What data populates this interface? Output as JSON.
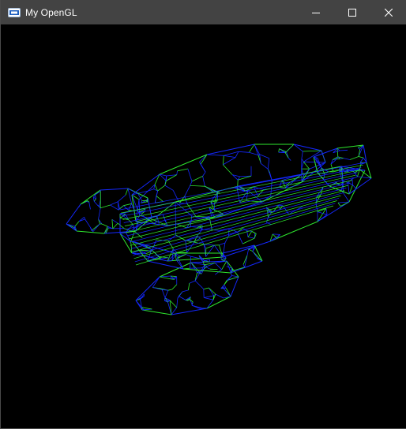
{
  "window": {
    "title": "My OpenGL",
    "app_icon": "opengl-window-icon",
    "controls": {
      "minimize_icon": "minimize-icon",
      "maximize_icon": "maximize-icon",
      "close_icon": "close-icon"
    }
  },
  "viewport": {
    "background": "#000000",
    "wire_colors": {
      "primary": "#1428ff",
      "secondary": "#2ee82e"
    }
  }
}
